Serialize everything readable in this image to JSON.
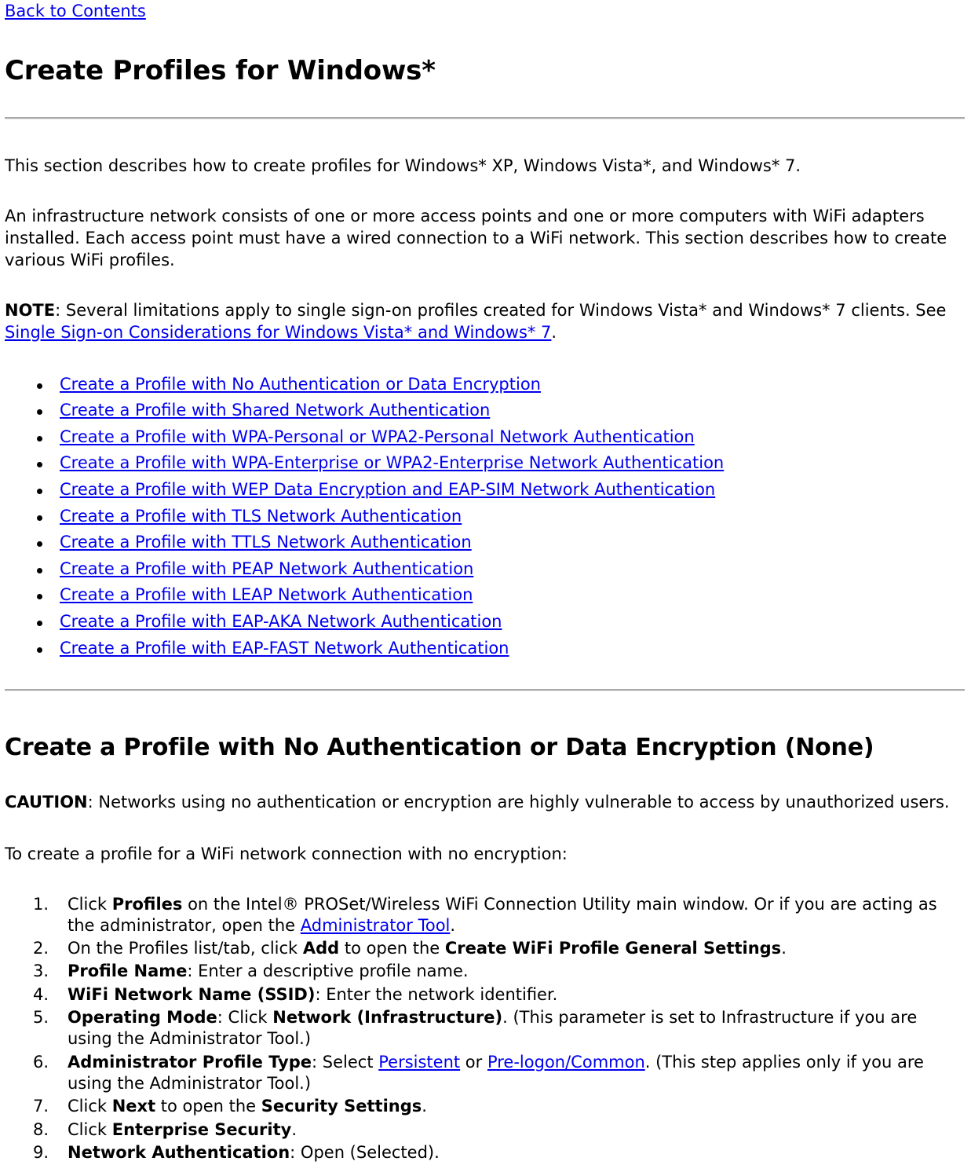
{
  "nav": {
    "back_to_contents": "Back to Contents"
  },
  "page_title": "Create Profiles for Windows*",
  "intro": {
    "paragraph": "This section describes how to create profiles for Windows* XP, Windows Vista*, and Windows* 7."
  },
  "infrastructure": {
    "paragraph": "An infrastructure network consists of one or more access points and one or more computers with WiFi adapters installed. Each access point must have a wired connection to a WiFi network. This section describes how to create various WiFi profiles."
  },
  "note": {
    "label": "NOTE",
    "text_before_link": ": Several limitations apply to single sign-on profiles created for Windows Vista* and Windows* 7 clients. See ",
    "link": "Single Sign-on Considerations for Windows Vista* and Windows* 7",
    "text_after_link": "."
  },
  "profile_links": [
    {
      "label": "Create a Profile with No Authentication or Data Encryption"
    },
    {
      "label": "Create a Profile with Shared Network Authentication"
    },
    {
      "label": "Create a Profile with WPA-Personal or WPA2-Personal Network Authentication"
    },
    {
      "label": "Create a Profile with WPA-Enterprise or WPA2-Enterprise Network Authentication"
    },
    {
      "label": "Create a Profile with WEP Data Encryption and EAP-SIM Network Authentication"
    },
    {
      "label": "Create a Profile with TLS Network Authentication"
    },
    {
      "label": "Create a Profile with TTLS Network Authentication"
    },
    {
      "label": "Create a Profile with PEAP Network Authentication"
    },
    {
      "label": "Create a Profile with LEAP Network Authentication"
    },
    {
      "label": "Create a Profile with EAP-AKA Network Authentication"
    },
    {
      "label": "Create a Profile with EAP-FAST Network Authentication"
    }
  ],
  "section": {
    "heading": "Create a Profile with No Authentication or Data Encryption (None)",
    "caution_label": "CAUTION",
    "caution_text": ": Networks using no authentication or encryption are highly vulnerable to access by unauthorized users.",
    "to_create": "To create a profile for a WiFi network connection with no encryption:"
  },
  "steps": {
    "step1": {
      "a": "Click ",
      "b1": "Profiles",
      "c": " on the Intel® PROSet/Wireless WiFi Connection Utility main window. Or if you are acting as the administrator, open the ",
      "link": "Administrator Tool",
      "d": "."
    },
    "step2": {
      "a": "On the Profiles list/tab, click ",
      "b1": "Add",
      "c": " to open the ",
      "b2": "Create WiFi Profile General Settings",
      "d": "."
    },
    "step3": {
      "b1": "Profile Name",
      "c": ": Enter a descriptive profile name."
    },
    "step4": {
      "b1": "WiFi Network Name (SSID)",
      "c": ": Enter the network identifier."
    },
    "step5": {
      "b1": "Operating Mode",
      "c": ": Click ",
      "b2": "Network (Infrastructure)",
      "d": ". (This parameter is set to Infrastructure if you are using the Administrator Tool.)"
    },
    "step6": {
      "b1": "Administrator Profile Type",
      "c": ": Select ",
      "link1": "Persistent",
      "d": " or ",
      "link2": "Pre-logon/Common",
      "e": ". (This step applies only if you are using the Administrator Tool.)"
    },
    "step7": {
      "a": "Click ",
      "b1": "Next",
      "c": " to open the ",
      "b2": "Security Settings",
      "d": "."
    },
    "step8": {
      "a": "Click ",
      "b1": "Enterprise Security",
      "c": "."
    },
    "step9": {
      "b1": "Network Authentication",
      "c": ": Open (Selected)."
    }
  },
  "colors": {
    "link": "#0000ee",
    "text": "#000000",
    "rule": "#a9a9a9",
    "background": "#ffffff"
  }
}
